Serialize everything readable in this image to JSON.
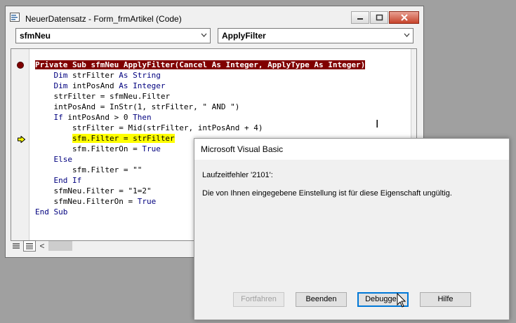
{
  "code_window": {
    "title": "NeuerDatensatz - Form_frmArtikel (Code)",
    "object_dropdown": "sfmNeu",
    "procedure_dropdown": "ApplyFilter"
  },
  "code": {
    "lines": [
      {
        "indent": "",
        "parts": [
          {
            "t": "Private Sub sfmNeu ApplyFilter(Cancel As Integer, ApplyType As Integer)",
            "s": "bp"
          }
        ]
      },
      {
        "indent": "    ",
        "parts": [
          {
            "t": "Dim",
            "s": "kw"
          },
          {
            "t": " strFilter ",
            "s": ""
          },
          {
            "t": "As String",
            "s": "kw"
          }
        ]
      },
      {
        "indent": "    ",
        "parts": [
          {
            "t": "Dim",
            "s": "kw"
          },
          {
            "t": " intPosAnd ",
            "s": ""
          },
          {
            "t": "As Integer",
            "s": "kw"
          }
        ]
      },
      {
        "indent": "    ",
        "parts": [
          {
            "t": "strFilter = sfmNeu.Filter",
            "s": ""
          }
        ]
      },
      {
        "indent": "    ",
        "parts": [
          {
            "t": "intPosAnd = InStr(1, strFilter, \" AND \")",
            "s": ""
          }
        ]
      },
      {
        "indent": "    ",
        "parts": [
          {
            "t": "If",
            "s": "kw"
          },
          {
            "t": " intPosAnd > 0 ",
            "s": ""
          },
          {
            "t": "Then",
            "s": "kw"
          }
        ]
      },
      {
        "indent": "        ",
        "parts": [
          {
            "t": "strFilter = Mid(strFilter, intPosAnd + 4)",
            "s": ""
          }
        ]
      },
      {
        "indent": "        ",
        "parts": [
          {
            "t": "sfm.Filter = strFilter",
            "s": "hl"
          }
        ]
      },
      {
        "indent": "        ",
        "parts": [
          {
            "t": "sfm.FilterOn = ",
            "s": ""
          },
          {
            "t": "True",
            "s": "kw"
          }
        ]
      },
      {
        "indent": "    ",
        "parts": [
          {
            "t": "Else",
            "s": "kw"
          }
        ]
      },
      {
        "indent": "        ",
        "parts": [
          {
            "t": "sfm.Filter = \"\"",
            "s": ""
          }
        ]
      },
      {
        "indent": "    ",
        "parts": [
          {
            "t": "End If",
            "s": "kw"
          }
        ]
      },
      {
        "indent": "    ",
        "parts": [
          {
            "t": "sfmNeu.Filter = \"1=2\"",
            "s": ""
          }
        ]
      },
      {
        "indent": "    ",
        "parts": [
          {
            "t": "sfmNeu.FilterOn = ",
            "s": ""
          },
          {
            "t": "True",
            "s": "kw"
          }
        ]
      },
      {
        "indent": "",
        "parts": [
          {
            "t": "End Sub",
            "s": "kw"
          }
        ]
      }
    ]
  },
  "dialog": {
    "title": "Microsoft Visual Basic",
    "error_line": "Laufzeitfehler '2101':",
    "message": "Die von Ihnen eingegebene Einstellung ist für diese Eigenschaft ungültig.",
    "buttons": {
      "continue": "Fortfahren",
      "end": "Beenden",
      "debug": "Debuggen",
      "help": "Hilfe"
    }
  },
  "colors": {
    "breakpoint": "#800000",
    "highlight": "#ffff00",
    "keyword": "#00007f",
    "accent": "#0078d7"
  }
}
